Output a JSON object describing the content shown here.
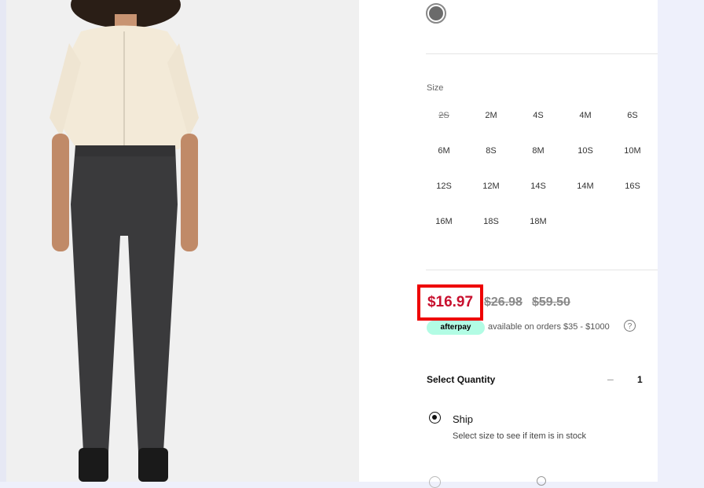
{
  "colors": {
    "accent_red": "#c8102e",
    "highlight_red": "#ee0000",
    "afterpay_mint": "#b2fce4",
    "swatch_selected": "#6b6b6b"
  },
  "product": {
    "image_alt": "Model wearing cream button-up shirt and washed black skinny jeans"
  },
  "size": {
    "label": "Size",
    "options": [
      {
        "label": "2S",
        "available": false
      },
      {
        "label": "2M",
        "available": true
      },
      {
        "label": "4S",
        "available": true
      },
      {
        "label": "4M",
        "available": true
      },
      {
        "label": "6S",
        "available": true
      },
      {
        "label": "6M",
        "available": true
      },
      {
        "label": "8S",
        "available": true
      },
      {
        "label": "8M",
        "available": true
      },
      {
        "label": "10S",
        "available": true
      },
      {
        "label": "10M",
        "available": true
      },
      {
        "label": "12S",
        "available": true
      },
      {
        "label": "12M",
        "available": true
      },
      {
        "label": "14S",
        "available": true
      },
      {
        "label": "14M",
        "available": true
      },
      {
        "label": "16S",
        "available": true
      },
      {
        "label": "16M",
        "available": true
      },
      {
        "label": "18S",
        "available": true
      },
      {
        "label": "18M",
        "available": true
      }
    ]
  },
  "price": {
    "sale": "$16.97",
    "was": "$26.98",
    "original": "$59.50"
  },
  "afterpay": {
    "badge": "afterpay",
    "text": "available on orders $35 - $1000",
    "help": "?"
  },
  "quantity": {
    "label": "Select Quantity",
    "minus": "–",
    "value": "1"
  },
  "shipping": {
    "option_label": "Ship",
    "note": "Select size to see if item is in stock"
  }
}
